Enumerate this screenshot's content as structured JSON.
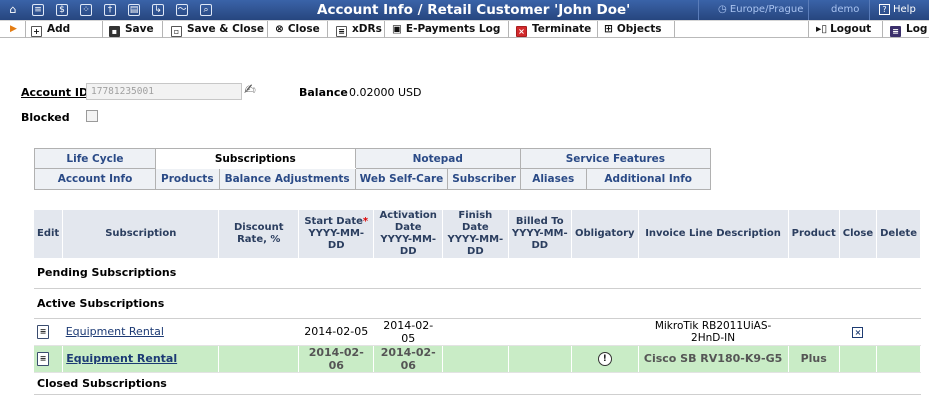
{
  "window": {
    "title": "Account Info / Retail Customer 'John Doe'",
    "timezone": "Europe/Prague",
    "user": "demo",
    "help": "Help"
  },
  "toolbar": {
    "add": "Add",
    "save": "Save",
    "save_close": "Save & Close",
    "close": "Close",
    "xdrs": "xDRs",
    "epayments": "E-Payments Log",
    "terminate": "Terminate",
    "objects": "Objects",
    "logout": "Logout",
    "log": "Log"
  },
  "account": {
    "id_label": "Account ID",
    "id_value": "17781235001",
    "balance_label": "Balance",
    "balance_value": "0.02000 USD",
    "blocked_label": "Blocked",
    "blocked": false
  },
  "tabs": {
    "row1": [
      "Life Cycle",
      "Subscriptions",
      "Notepad",
      "Service Features"
    ],
    "row2": [
      "Account Info",
      "Products",
      "Balance Adjustments",
      "Web Self-Care",
      "Subscriber",
      "Aliases",
      "Additional Info"
    ],
    "active": "Subscriptions"
  },
  "table": {
    "headers": {
      "edit": "Edit",
      "subscription": "Subscription",
      "discount": "Discount Rate, %",
      "start_date": "Start Date",
      "start_fmt": "YYYY-MM-DD",
      "activation": "Activation Date",
      "activation_fmt": "YYYY-MM-DD",
      "finish": "Finish Date",
      "finish_fmt": "YYYY-MM-DD",
      "billed": "Billed To",
      "billed_fmt": "YYYY-MM-DD",
      "obligatory": "Obligatory",
      "invoice": "Invoice Line Description",
      "product": "Product",
      "close": "Close",
      "delete": "Delete"
    },
    "sections": {
      "pending": "Pending Subscriptions",
      "active": "Active Subscriptions",
      "closed": "Closed Subscriptions"
    },
    "rows": [
      {
        "subscription": "Equipment Rental",
        "discount": "",
        "start_date": "2014-02-05",
        "activation_date": "2014-02-05",
        "finish_date": "",
        "billed_to": "",
        "obligatory": false,
        "invoice": "MikroTik RB2011UiAS-2HnD-IN",
        "product": "",
        "closable": true
      },
      {
        "subscription": "Equipment Rental",
        "discount": "",
        "start_date": "2014-02-06",
        "activation_date": "2014-02-06",
        "finish_date": "",
        "billed_to": "",
        "obligatory": true,
        "invoice": "Cisco SB RV180-K9-G5",
        "product": "Plus",
        "closable": false
      }
    ]
  },
  "colors": {
    "header_blue": "#2d4f8f",
    "highlight_green": "#c9ecc6",
    "column_header": "#e3e7ee"
  }
}
